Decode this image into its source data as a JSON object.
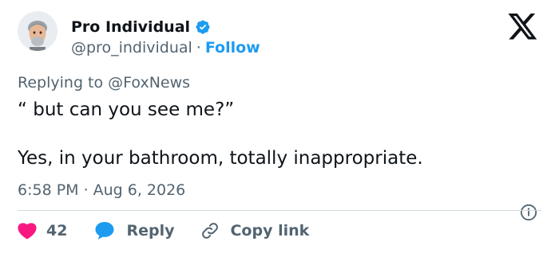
{
  "author": {
    "display_name": "Pro Individual",
    "handle": "@pro_individual",
    "separator": "·",
    "follow_label": "Follow",
    "verified": true
  },
  "brand": {
    "logo": "x-logo-icon"
  },
  "tweet": {
    "replying_prefix": "Replying to",
    "replying_to": "@FoxNews",
    "line1": "“ but can you see me?”",
    "line2": "Yes, in your bathroom, totally inappropriate.",
    "time": "6:58 PM",
    "meta_separator": "·",
    "date": "Aug 6, 2026"
  },
  "actions": {
    "like_count": "42",
    "reply_label": "Reply",
    "copy_label": "Copy link"
  },
  "colors": {
    "accent": "#1d9bf0",
    "like": "#f91880",
    "text": "#0f1419",
    "muted": "#536471"
  }
}
